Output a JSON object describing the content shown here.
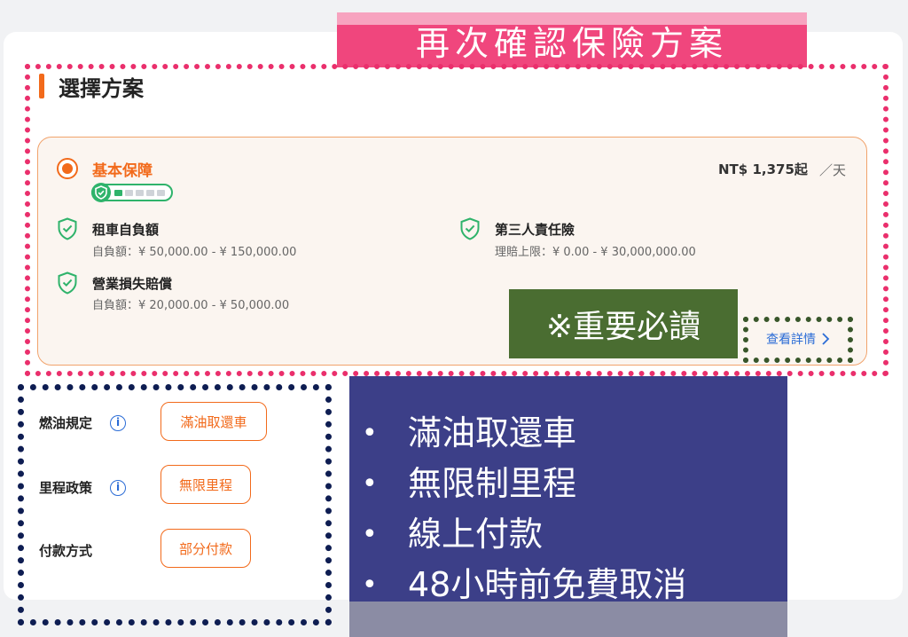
{
  "banner": {
    "title": "再次確認保險方案"
  },
  "section": {
    "title": "選擇方案"
  },
  "plan": {
    "name": "基本保障",
    "price": "NT$ 1,375起",
    "per_day": "／天",
    "level_of_5": 1,
    "coverages": [
      {
        "title": "租車自負額",
        "detail": "自負額：¥ 50,000.00 - ¥ 150,000.00"
      },
      {
        "title": "第三人責任險",
        "detail": "理賠上限：¥ 0.00 - ¥ 30,000,000.00"
      },
      {
        "title": "營業損失賠償",
        "detail": "自負額：¥ 20,000.00 - ¥ 50,000.00"
      }
    ],
    "detail_link": "查看詳情"
  },
  "notice": {
    "label": "※重要必讀"
  },
  "policies": [
    {
      "label": "燃油規定",
      "info_icon": "i",
      "value": "滿油取還車"
    },
    {
      "label": "里程政策",
      "info_icon": "i",
      "value": "無限里程"
    },
    {
      "label": "付款方式",
      "value": "部分付款"
    }
  ],
  "highlights": [
    "滿油取還車",
    "無限制里程",
    "線上付款",
    "48小時前免費取消"
  ],
  "colors": {
    "accent_orange": "#f26a1b",
    "banner_pink": "#f0467d",
    "frame_pink": "#ea2f6c",
    "frame_navy": "#0e1d52",
    "notice_green": "#4a6d31",
    "panel_blue": "#3c3f88",
    "shield_green": "#2fb36b",
    "link_blue": "#2b6cd6"
  }
}
